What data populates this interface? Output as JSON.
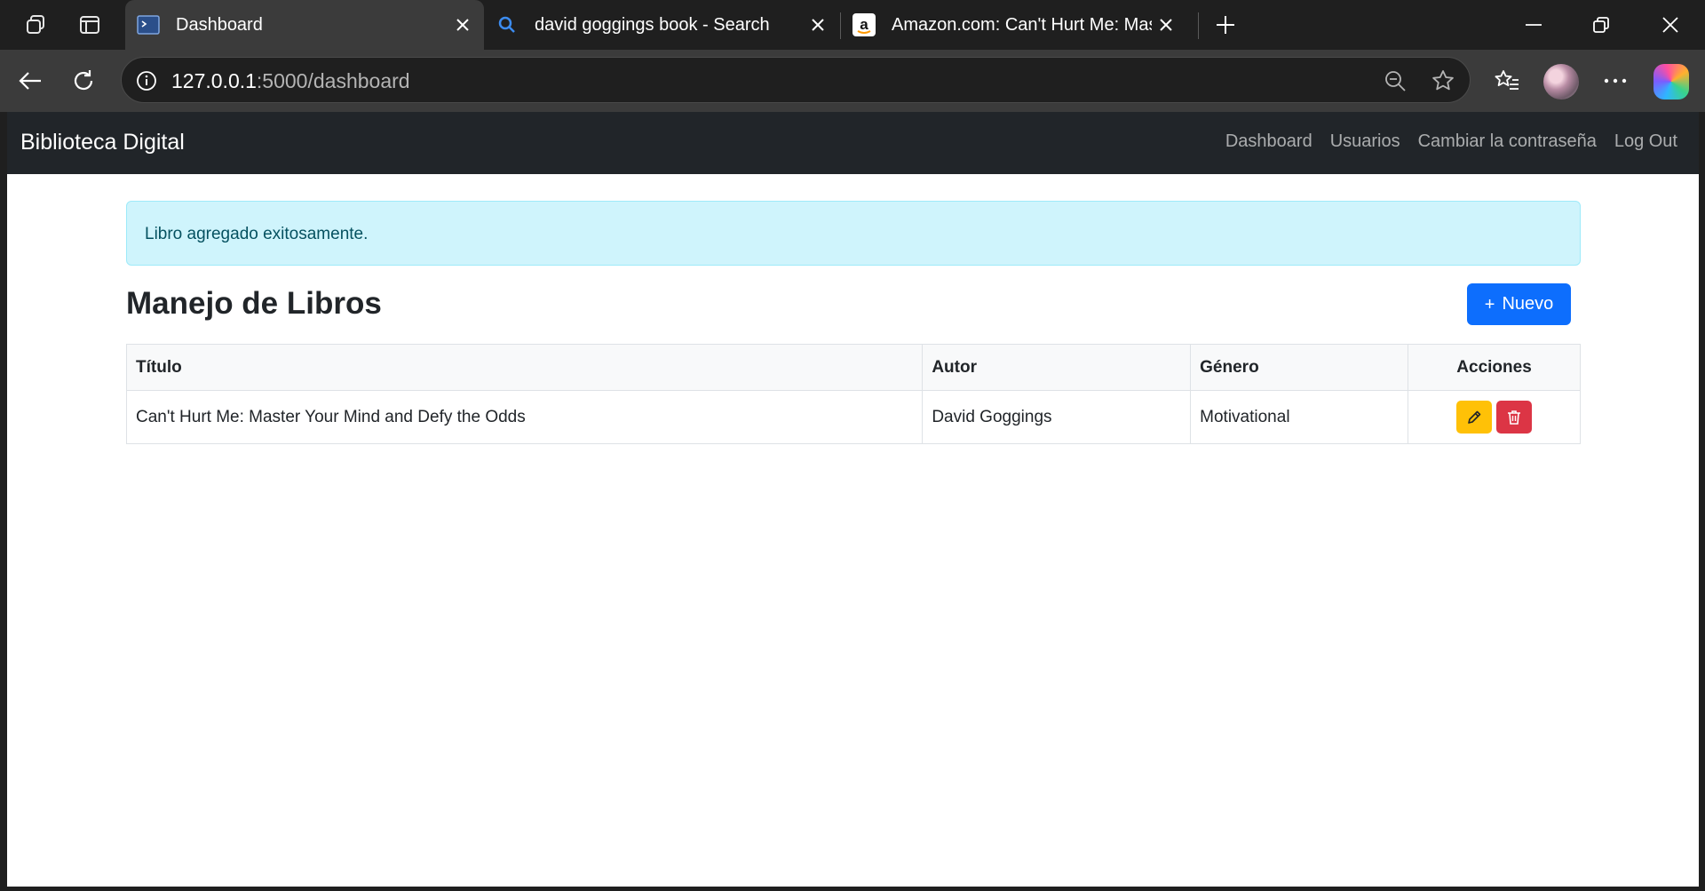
{
  "browser": {
    "tabs": [
      {
        "title": "Dashboard",
        "active": true
      },
      {
        "title": "david goggings book - Search",
        "active": false
      },
      {
        "title": "Amazon.com: Can't Hurt Me: Mas",
        "active": false
      }
    ],
    "address": {
      "host": "127.0.0.1",
      "path": ":5000/dashboard"
    },
    "icons": {
      "workspaces": "workspaces-icon",
      "tab_actions": "tab-actions-icon",
      "back": "back-arrow-icon",
      "refresh": "refresh-icon",
      "site_info": "info-icon",
      "zoom": "zoom-out-icon",
      "favorite": "star-icon",
      "favorites": "favorites-icon",
      "more": "more-icon",
      "copilot": "copilot-icon"
    }
  },
  "app": {
    "brand": "Biblioteca Digital",
    "nav": [
      "Dashboard",
      "Usuarios",
      "Cambiar la contraseña",
      "Log Out"
    ],
    "alert": "Libro agregado exitosamente.",
    "page_title": "Manejo de Libros",
    "new_button": {
      "icon": "+",
      "label": "Nuevo"
    },
    "table": {
      "headers": [
        "Título",
        "Autor",
        "Género",
        "Acciones"
      ],
      "rows": [
        {
          "title": "Can't Hurt Me: Master Your Mind and Defy the Odds",
          "author": "David Goggings",
          "genre": "Motivational"
        }
      ]
    }
  },
  "colors": {
    "primary": "#0d6efd",
    "warning": "#ffc107",
    "danger": "#dc3545",
    "alert_bg": "#cff4fc",
    "navbar": "#212529"
  }
}
